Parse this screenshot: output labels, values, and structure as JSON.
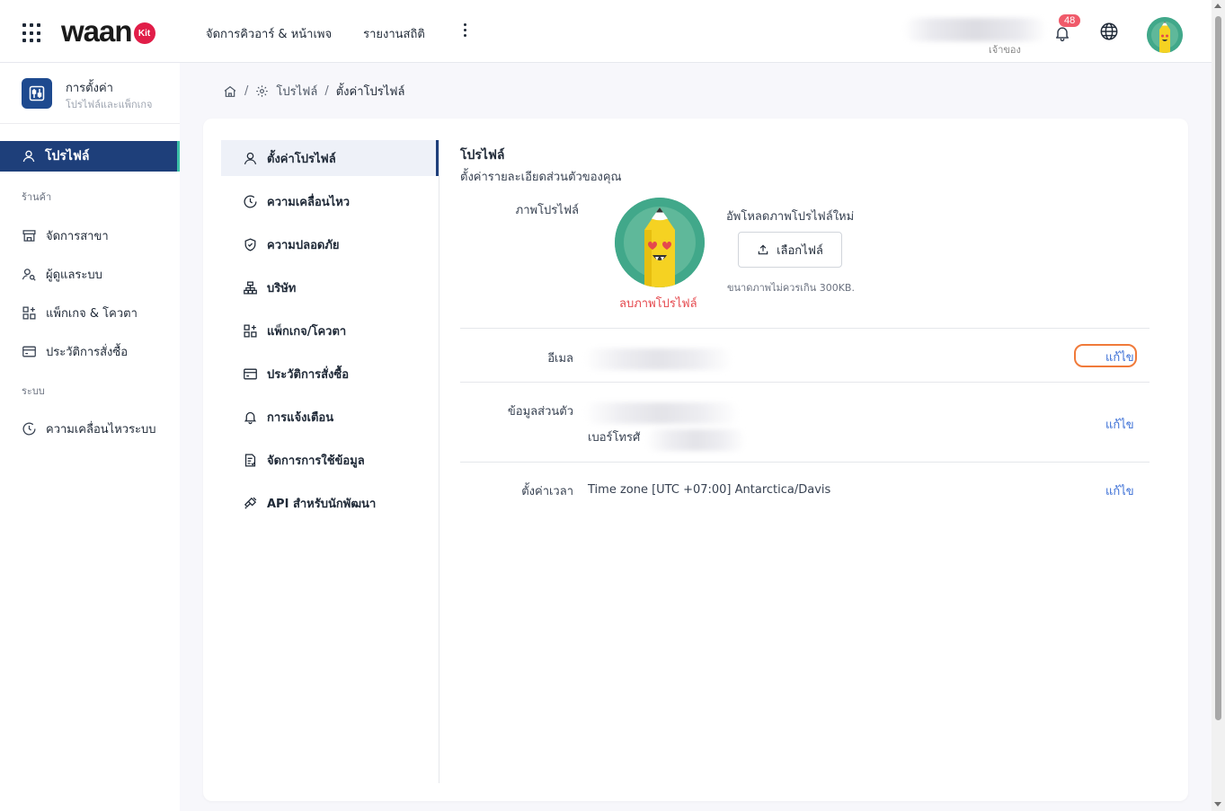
{
  "header": {
    "logo_text": "waan",
    "logo_badge": "Kit",
    "nav": [
      "จัดการคิวอาร์ & หน้าเพจ",
      "รายงานสถิติ"
    ],
    "role": "เจ้าของ",
    "notification_count": "48"
  },
  "sidebar": {
    "title": "การตั้งค่า",
    "subtitle": "โปรไฟล์และแพ็กเกจ",
    "active_label": "โปรไฟล์",
    "section_store": "ร้านค้า",
    "store_items": [
      "จัดการสาขา",
      "ผู้ดูแลระบบ",
      "แพ็กเกจ & โควตา",
      "ประวัติการสั่งซื้อ"
    ],
    "section_system": "ระบบ",
    "system_items": [
      "ความเคลื่อนไหวระบบ"
    ]
  },
  "breadcrumb": {
    "item1": "โปรไฟล์",
    "item2": "ตั้งค่าโปรไฟล์"
  },
  "menu": [
    {
      "label": "ตั้งค่าโปรไฟล์",
      "icon": "user-icon"
    },
    {
      "label": "ความเคลื่อนไหว",
      "icon": "history-icon"
    },
    {
      "label": "ความปลอดภัย",
      "icon": "shield-icon"
    },
    {
      "label": "บริษัท",
      "icon": "org-icon"
    },
    {
      "label": "แพ็กเกจ/โควตา",
      "icon": "package-icon"
    },
    {
      "label": "ประวัติการสั่งซื้อ",
      "icon": "card-icon"
    },
    {
      "label": "การแจ้งเตือน",
      "icon": "bell-icon"
    },
    {
      "label": "จัดการการใช้ข้อมูล",
      "icon": "document-icon"
    },
    {
      "label": "API สำหรับนักพัฒนา",
      "icon": "api-icon"
    }
  ],
  "profile": {
    "title": "โปรไฟล์",
    "subtitle": "ตั้งค่ารายละเอียดส่วนตัวของคุณ",
    "picture_label": "ภาพโปรไฟล์",
    "remove_picture": "ลบภาพโปรไฟล์",
    "upload_label": "อัพโหลดภาพโปรไฟล์ใหม่",
    "choose_file": "เลือกไฟล์",
    "upload_hint": "ขนาดภาพไม่ควรเกิน 300KB.",
    "email_label": "อีเมล",
    "personal_label": "ข้อมูลส่วนตัว",
    "phone_label": "เบอร์โทรศั",
    "timezone_label": "ตั้งค่าเวลา",
    "timezone_value": "Time zone [UTC +07:00] Antarctica/Davis",
    "edit": "แก้ไข"
  },
  "colors": {
    "primary": "#1e3f7a",
    "accent": "#3cc1a7",
    "link": "#3b6fd6",
    "danger": "#e5484d",
    "highlight": "#f07a3a"
  }
}
